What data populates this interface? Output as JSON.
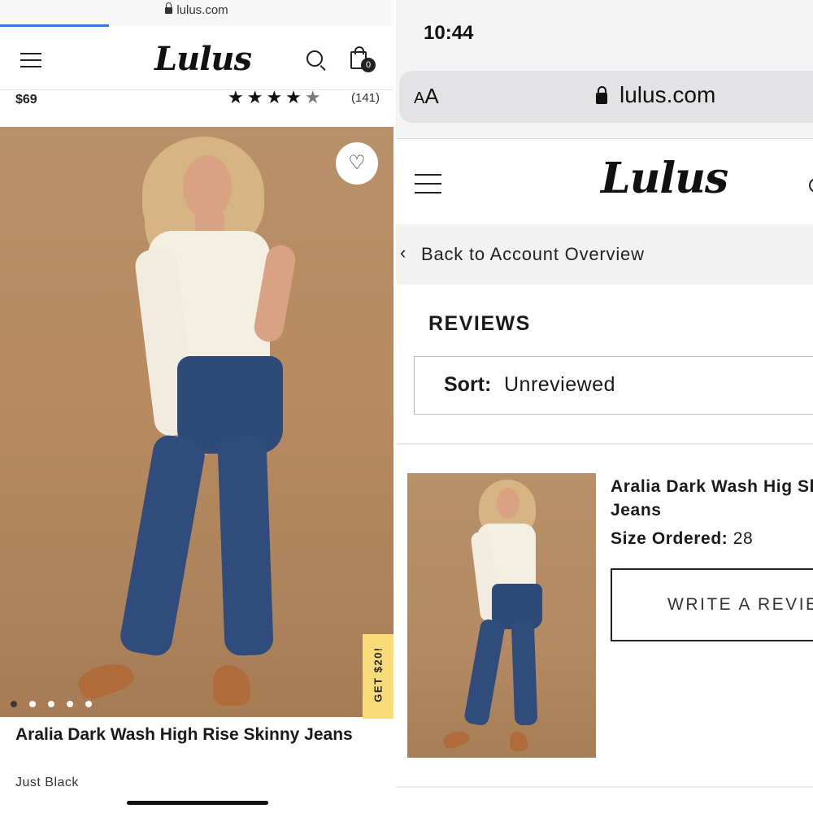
{
  "left_screen": {
    "browser": {
      "url": "lulus.com"
    },
    "header": {
      "logo_text": "Lulus",
      "cart_count": "0"
    },
    "product": {
      "price": "$69",
      "rating_stars": 4.5,
      "review_count": "(141)",
      "title": "Aralia Dark Wash High Rise Skinny Jeans",
      "color": "Just Black",
      "image_dots": 5,
      "active_dot": 1
    },
    "promo_tab": "GET $20!",
    "icons": [
      "menu-icon",
      "search-icon",
      "shopping-bag-icon",
      "heart-icon"
    ]
  },
  "right_screen": {
    "status_bar": {
      "time": "10:44"
    },
    "browser": {
      "text_size_button": "AA",
      "url": "lulus.com"
    },
    "header": {
      "logo_text": "Lulus"
    },
    "back_link": "Back to Account Overview",
    "section_title": "REVIEWS",
    "sort": {
      "label": "Sort:",
      "value": "Unreviewed"
    },
    "review_item": {
      "title": "Aralia Dark Wash High Rise Skinny Jeans",
      "title_visible": "Aralia Dark Wash Hig Skinny Jeans",
      "size_label": "Size Ordered:",
      "size_value": "28",
      "button_label": "WRITE A REVIEW"
    }
  },
  "colors": {
    "backdrop": "#b88a60",
    "promo_yellow": "#f9db79",
    "progress_blue": "#2d7be0",
    "denim": "#2e4a78"
  }
}
